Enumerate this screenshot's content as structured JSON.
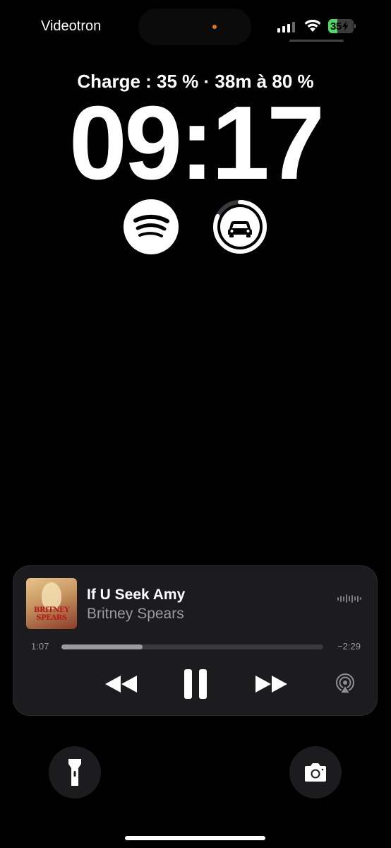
{
  "status_bar": {
    "carrier": "Videotron",
    "battery_percent": "35",
    "icons": [
      "cellular-signal-icon",
      "wifi-icon",
      "battery-charging-icon"
    ]
  },
  "lockscreen": {
    "charge_status": "Charge : 35 % · 38m à 80 %",
    "time": "09:17",
    "widgets": [
      {
        "name": "spotify-widget",
        "icon": "spotify-icon"
      },
      {
        "name": "car-widget",
        "icon": "car-icon",
        "ring_fraction": 0.82
      }
    ]
  },
  "now_playing": {
    "album_art_text": "BRITNEY SPEARS",
    "title": "If U Seek Amy",
    "artist": "Britney Spears",
    "elapsed": "1:07",
    "remaining": "−2:29",
    "progress_fraction": 0.31,
    "controls": [
      "rewind-icon",
      "pause-icon",
      "fast-forward-icon",
      "airplay-icon"
    ]
  },
  "quick_actions": [
    "flashlight-icon",
    "camera-icon"
  ],
  "colors": {
    "background": "#000000",
    "card": "#1c1c1e",
    "battery_green": "#4cd964",
    "secondary_text": "#9a9a9f"
  }
}
